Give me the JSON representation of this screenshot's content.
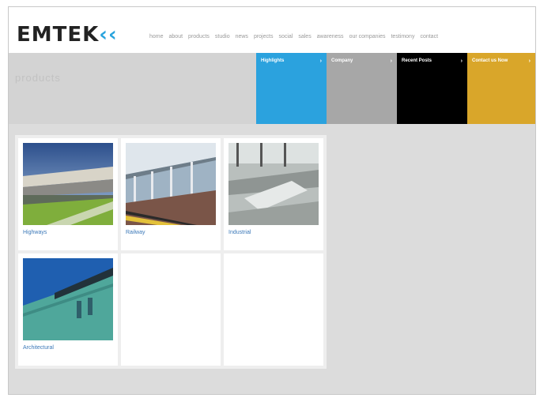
{
  "brand": {
    "logo_text": "EMTEK",
    "logo_mark": "‹‹",
    "accent": "#2aa4dd"
  },
  "nav": {
    "items": [
      "home",
      "about",
      "products",
      "studio",
      "news",
      "projects",
      "social",
      "sales",
      "awareness",
      "our companies",
      "testimony",
      "contact"
    ]
  },
  "page": {
    "title": "products"
  },
  "tiles": [
    {
      "label": "Highlights",
      "color": "#2ba2de",
      "text_color": "#ffffff"
    },
    {
      "label": "Company",
      "color": "#a7a7a7",
      "text_color": "#ffffff"
    },
    {
      "label": "Recent Posts",
      "color": "#000000",
      "text_color": "#ffffff"
    },
    {
      "label": "Contact us Now",
      "color": "#d9a62a",
      "text_color": "#ffffff"
    }
  ],
  "tile_arrow": "›",
  "products": [
    {
      "caption": "Highways",
      "image": "stadium"
    },
    {
      "caption": "Railway",
      "image": "station"
    },
    {
      "caption": "Industrial",
      "image": "interior"
    },
    {
      "caption": "Architectural",
      "image": "facade"
    }
  ]
}
